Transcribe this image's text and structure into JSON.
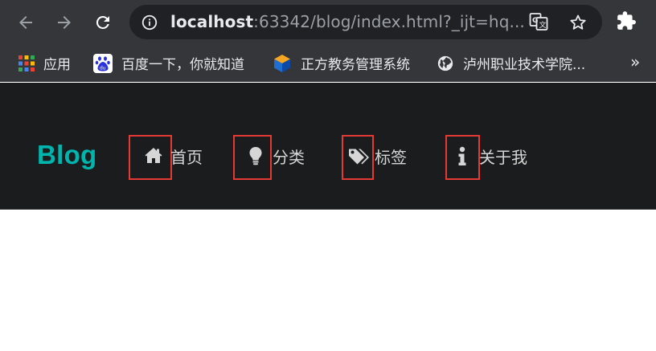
{
  "browser": {
    "url_host": "localhost",
    "url_rest": ":63342/blog/index.html?_ijt=hq...",
    "icons": {
      "back": "back-arrow-icon",
      "forward": "forward-arrow-icon",
      "reload": "reload-icon",
      "site_info": "info-icon",
      "translate": "translate-icon",
      "bookmark": "star-icon",
      "extensions": "puzzle-icon"
    }
  },
  "bookmarks": [
    {
      "label": "应用",
      "icon": "apps-grid-icon"
    },
    {
      "label": "百度一下，你就知道",
      "icon": "baidu-paw-icon"
    },
    {
      "label": "正方教务管理系统",
      "icon": "zhengfang-cube-icon"
    },
    {
      "label": "泸州职业技术学院...",
      "icon": "globe-icon"
    }
  ],
  "bookmarks_more": "»",
  "site": {
    "logo": "Blog",
    "logo_color": "#00b5ad",
    "menu": [
      {
        "label": "首页",
        "icon": "home-icon"
      },
      {
        "label": "分类",
        "icon": "lightbulb-icon"
      },
      {
        "label": "标签",
        "icon": "tags-icon"
      },
      {
        "label": "关于我",
        "icon": "info-icon"
      }
    ],
    "highlight_color": "#e53935"
  }
}
